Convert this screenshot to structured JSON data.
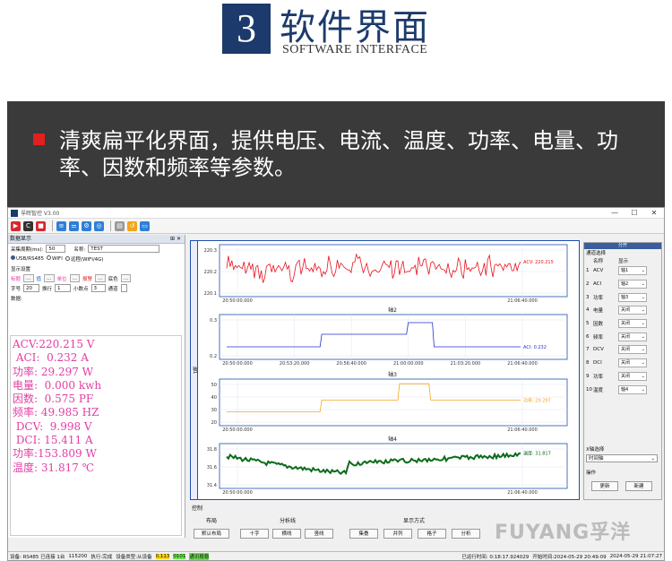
{
  "header": {
    "number": "3",
    "title_cn": "软件界面",
    "title_en": "SOFTWARE INTERFACE"
  },
  "banner": {
    "text": "清爽扁平化界面，提供电压、电流、温度、功率、电量、功率、因数和频率等参数。"
  },
  "app": {
    "title": "孚晖智控 V3.00",
    "window_controls": [
      "—",
      "☐",
      "✕"
    ],
    "left_panel": {
      "title": "数据显示",
      "sample_label": "采集周期(ms):",
      "sample_value": "50",
      "name_label": "名称:",
      "name_value": "TEST",
      "conn_options": [
        "USB/RS485",
        "WIFI",
        "远程(WIFI/4G)"
      ],
      "display_settings": "显示设置",
      "color_items": [
        "标题",
        "值",
        "单位",
        "报警",
        "底色"
      ],
      "font_label": "字号",
      "font_value": "20",
      "row_label": "换行",
      "row_value": "1",
      "decimal_label": "小数点",
      "decimal_value": "3",
      "pass_label": "通道",
      "data_label": "数据:",
      "readings": [
        "ACV:220.215 V",
        " ACI:  0.232 A",
        "功率: 29.297 W",
        "电量:  0.000 kwh",
        "因数:  0.575 PF",
        "频率: 49.985 HZ",
        " DCV:  9.998 V",
        " DCI: 15.411 A",
        "功率:153.809 W",
        "温度: 31.817 ℃"
      ]
    },
    "charts": [
      {
        "title": "",
        "ylabels": [
          "220.3",
          "220.2",
          "220.1"
        ],
        "xlabels": [
          "20:50:00.000",
          "21:06:40.000"
        ],
        "series_label": "ACV: 220.215",
        "color": "#e8121c"
      },
      {
        "title": "轴2",
        "ylabels": [
          "0.3",
          "0.2"
        ],
        "xlabels": [
          "20:50:00.000",
          "20:53:20.000",
          "20:56:40.000",
          "21:00:00.000",
          "21:03:20.000",
          "21:06:40.000"
        ],
        "series_label": "ACI: 0.232",
        "color": "#2233cc"
      },
      {
        "title": "轴3",
        "ylabels": [
          "50",
          "40",
          "30",
          "20"
        ],
        "xlabels": [
          "20:50:00.000",
          "21:06:40.000"
        ],
        "series_label": "功率: 29.297",
        "color": "#f5a623"
      },
      {
        "title": "轴4",
        "ylabels": [
          "31.8",
          "31.6",
          "31.4"
        ],
        "xlabels": [
          "20:50:00.000",
          "21:06:40.000"
        ],
        "series_label": "温度: 31.817",
        "color": "#0b6b1a"
      }
    ],
    "vertical_axis_label": "轴1",
    "right_panel": {
      "title": "通道选择",
      "group_label": "分开",
      "col_name": "名称",
      "col_show": "显示",
      "channels": [
        {
          "no": "1",
          "name": "ACV",
          "show": "轴1"
        },
        {
          "no": "2",
          "name": "ACI",
          "show": "轴2"
        },
        {
          "no": "3",
          "name": "功率",
          "show": "轴3"
        },
        {
          "no": "4",
          "name": "电量",
          "show": "关闭"
        },
        {
          "no": "5",
          "name": "因数",
          "show": "关闭"
        },
        {
          "no": "6",
          "name": "频率",
          "show": "关闭"
        },
        {
          "no": "7",
          "name": "DCV",
          "show": "关闭"
        },
        {
          "no": "8",
          "name": "DCI",
          "show": "关闭"
        },
        {
          "no": "9",
          "name": "功率",
          "show": "关闭"
        },
        {
          "no": "10",
          "name": "温度",
          "show": "轴4"
        }
      ],
      "x_axis_label": "X轴选择",
      "x_axis_value": "时间轴",
      "ops_label": "操作",
      "refresh": "更新",
      "new": "新建"
    },
    "control": {
      "title": "控制",
      "layout_label": "布局",
      "layout_btn": "默认布局",
      "analysis_label": "分析线",
      "analysis_btns": [
        "十字",
        "横线",
        "竖线"
      ],
      "display_label": "显示方式",
      "display_btns": [
        "集叠",
        "并列",
        "格子",
        "分析"
      ],
      "brand": "FUYANG孚洋"
    },
    "status": {
      "items": [
        "设备: RS485 已连接 1台",
        "115200",
        "执行:完成",
        "设备类型:从设备",
        "0.113",
        "0101",
        "通讯稳稳"
      ],
      "elapsed": "已运行时间: 0:18:17.924029",
      "start": "开始时间:2024-05-29 20:49:09",
      "now": "2024-05-29 21:07:27"
    }
  }
}
